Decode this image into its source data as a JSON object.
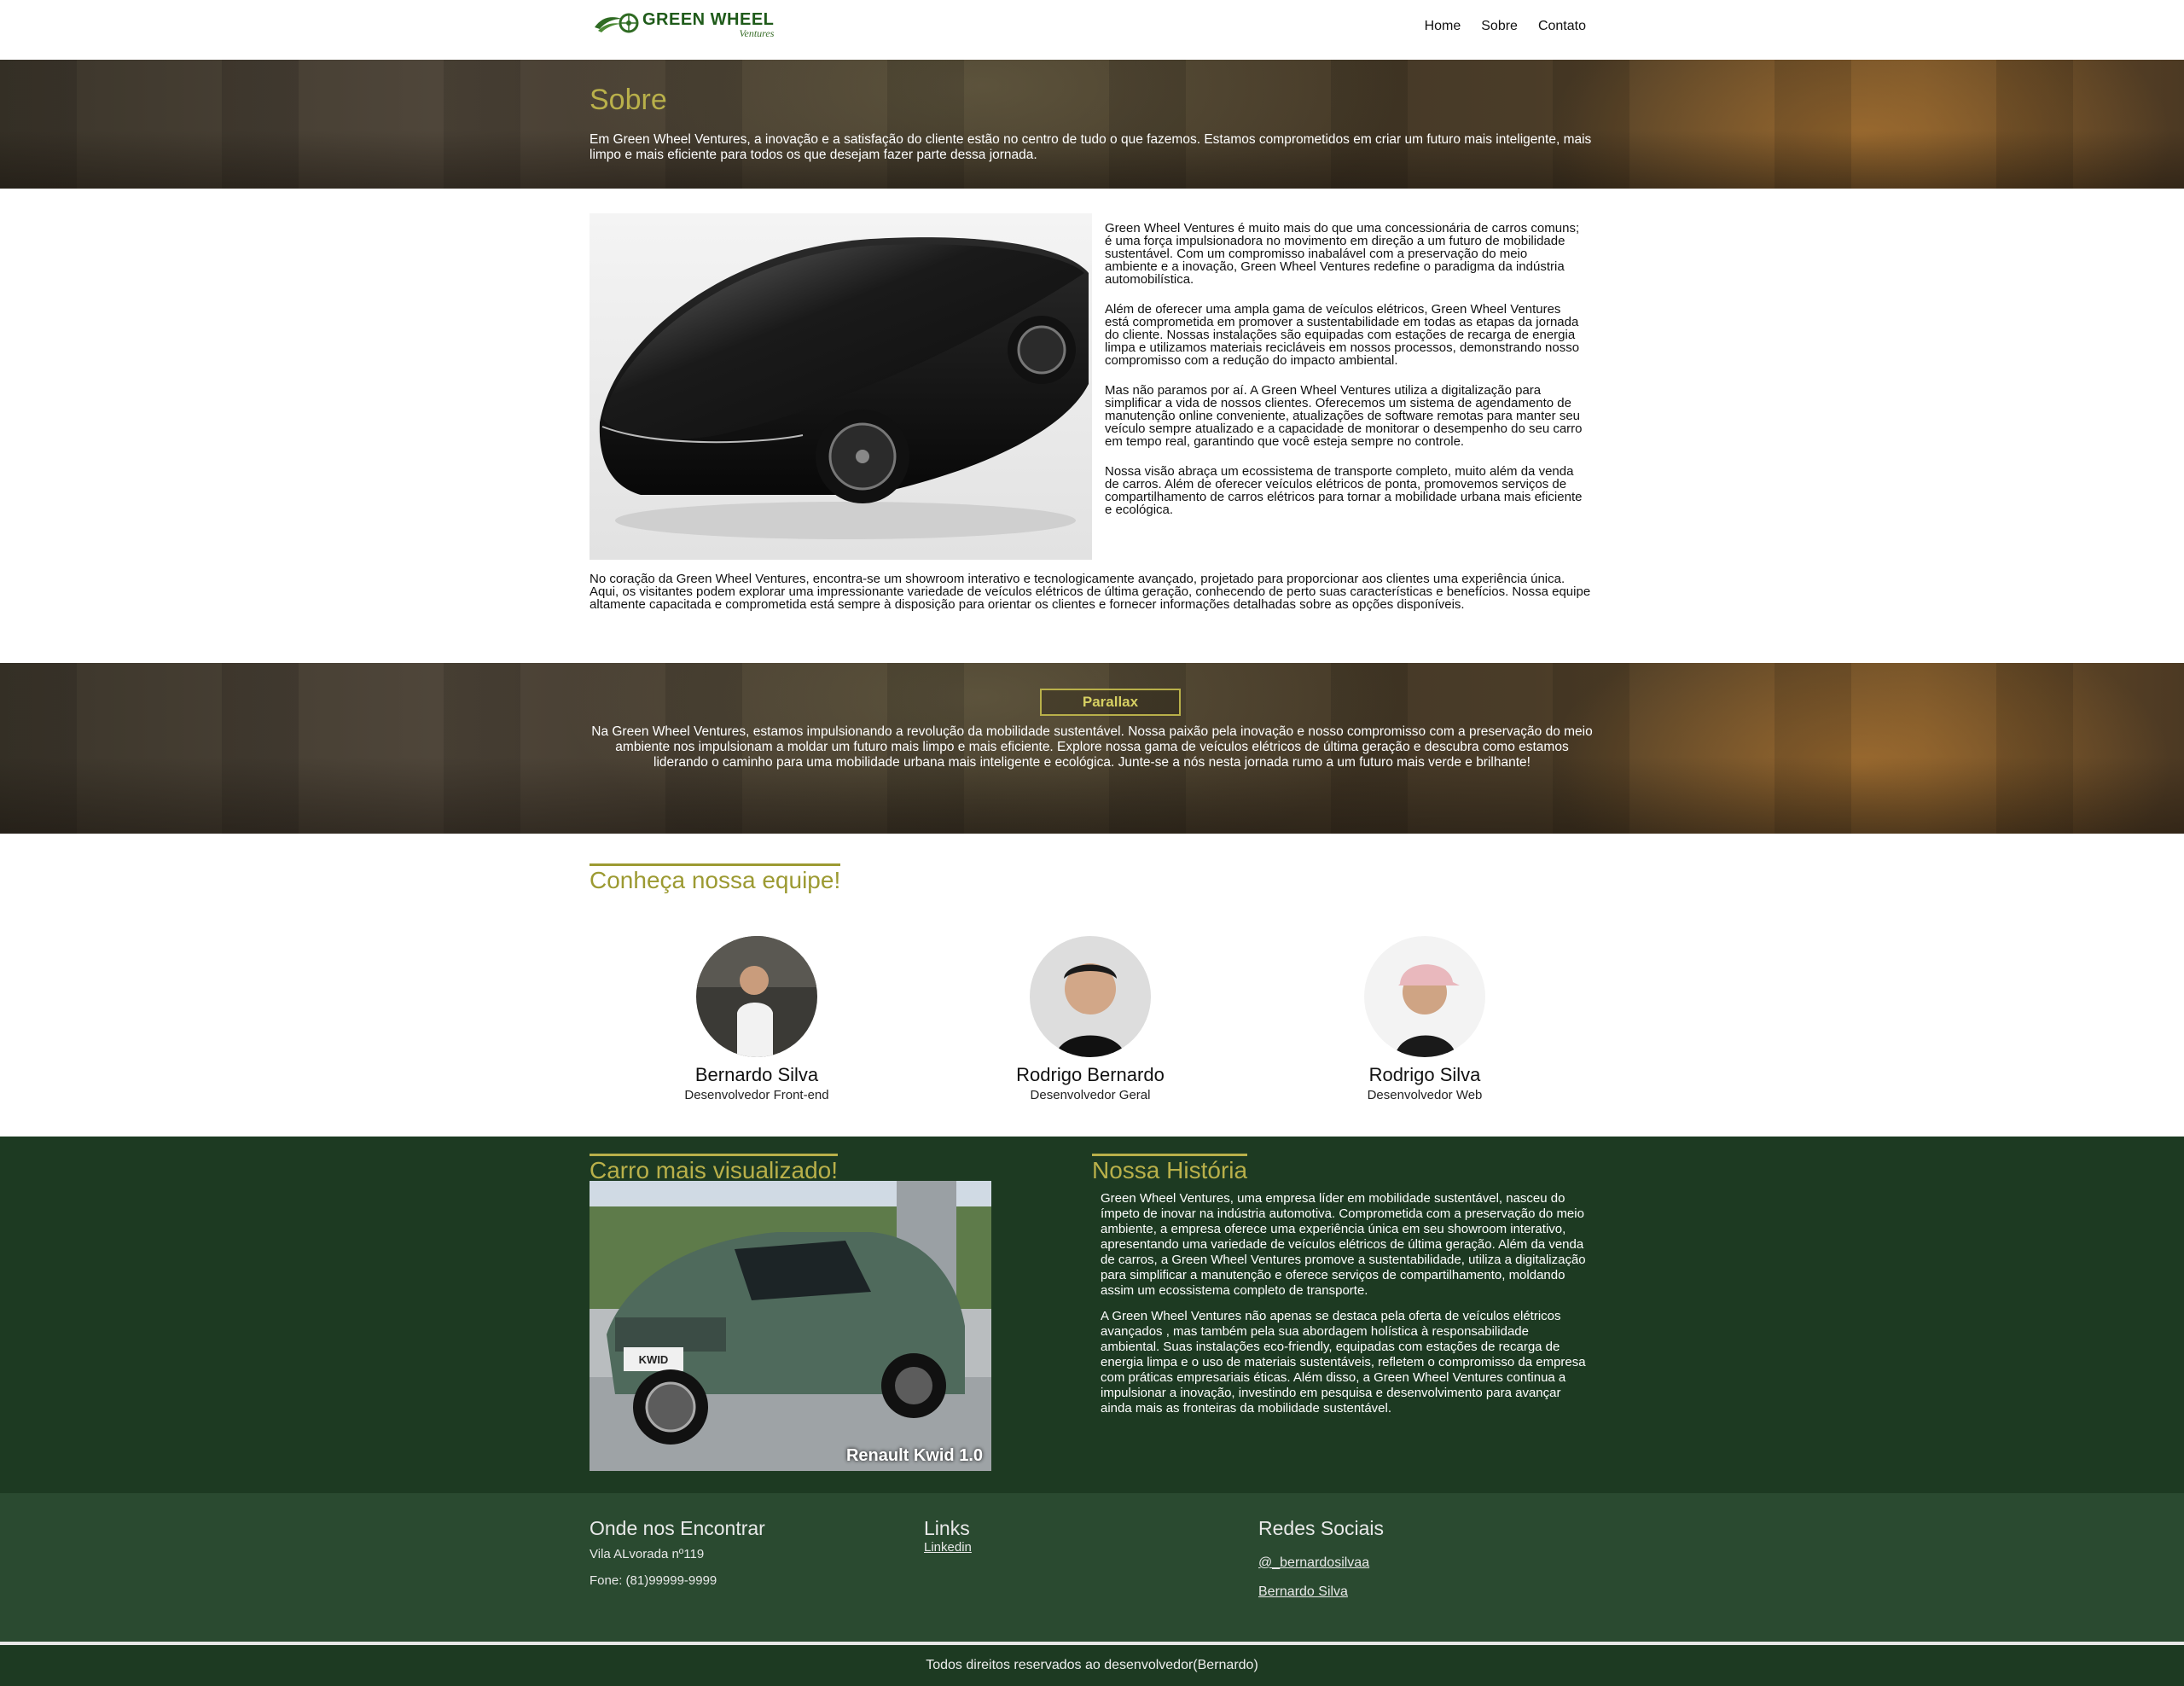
{
  "header": {
    "logo_text": "GREEN WHEEL",
    "logo_sub": "Ventures",
    "nav": [
      "Home",
      "Sobre",
      "Contato"
    ]
  },
  "sobre": {
    "title": "Sobre",
    "text": "Em Green Wheel Ventures, a inovação e a satisfação do cliente estão no centro de tudo o que fazemos. Estamos comprometidos em criar um futuro mais inteligente, mais limpo e mais eficiente para todos os que desejam fazer parte dessa jornada."
  },
  "about": {
    "paragraphs": [
      "Green Wheel Ventures é muito mais do que uma concessionária de carros comuns; é uma força impulsionadora no movimento em direção a um futuro de mobilidade sustentável. Com um compromisso inabalável com a preservação do meio ambiente e a inovação, Green Wheel Ventures redefine o paradigma da indústria automobilística.",
      "Além de oferecer uma ampla gama de veículos elétricos, Green Wheel Ventures está comprometida em promover a sustentabilidade em todas as etapas da jornada do cliente. Nossas instalações são equipadas com estações de recarga de energia limpa e utilizamos materiais recicláveis em nossos processos, demonstrando nosso compromisso com a redução do impacto ambiental.",
      "Mas não paramos por aí. A Green Wheel Ventures utiliza a digitalização para simplificar a vida de nossos clientes. Oferecemos um sistema de agendamento de manutenção online conveniente, atualizações de software remotas para manter seu veículo sempre atualizado e a capacidade de monitorar o desempenho do seu carro em tempo real, garantindo que você esteja sempre no controle.",
      "Nossa visão abraça um ecossistema de transporte completo, muito além da venda de carros. Além de oferecer veículos elétricos de ponta, promovemos serviços de compartilhamento de carros elétricos para tornar a mobilidade urbana mais eficiente e ecológica."
    ],
    "bottom": "No coração da Green Wheel Ventures, encontra-se um showroom interativo e tecnologicamente avançado, projetado para proporcionar aos clientes uma experiência única. Aqui, os visitantes podem explorar uma impressionante variedade de veículos elétricos de última geração, conhecendo de perto suas características e benefícios. Nossa equipe altamente capacitada e comprometida está sempre à disposição para orientar os clientes e fornecer informações detalhadas sobre as opções disponíveis."
  },
  "parallax": {
    "button": "Parallax",
    "text": "Na Green Wheel Ventures, estamos impulsionando a revolução da mobilidade sustentável. Nossa paixão pela inovação e nosso compromisso com a preservação do meio ambiente nos impulsionam a moldar um futuro mais limpo e mais eficiente. Explore nossa gama de veículos elétricos de última geração e descubra como estamos liderando o caminho para uma mobilidade urbana mais inteligente e ecológica. Junte-se a nós nesta jornada rumo a um futuro mais verde e brilhante!"
  },
  "team": {
    "title": "Conheça nossa equipe!",
    "members": [
      {
        "name": "Bernardo Silva",
        "role": "Desenvolvedor Front-end"
      },
      {
        "name": "Rodrigo Bernardo",
        "role": "Desenvolvedor Geral"
      },
      {
        "name": "Rodrigo Silva",
        "role": "Desenvolvedor Web"
      }
    ]
  },
  "featured": {
    "title": "Carro mais visualizado!",
    "caption": "Renault Kwid 1.0",
    "plate": "KWID"
  },
  "history": {
    "title": "Nossa História",
    "paragraphs": [
      "Green Wheel Ventures, uma empresa líder em mobilidade sustentável, nasceu do ímpeto de inovar na indústria automotiva. Comprometida com a preservação do meio ambiente, a empresa oferece uma experiência única em seu showroom interativo, apresentando uma variedade de veículos elétricos de última geração. Além da venda de carros, a Green Wheel Ventures promove a sustentabilidade, utiliza a digitalização para simplificar a manutenção e oferece serviços de compartilhamento, moldando assim um ecossistema completo de transporte.",
      "A Green Wheel Ventures não apenas se destaca pela oferta de veículos elétricos avançados , mas também pela sua abordagem holística à responsabilidade ambiental. Suas instalações eco-friendly, equipadas com estações de recarga de energia limpa e o uso de materiais sustentáveis, refletem o compromisso da empresa com práticas empresariais éticas. Além disso, a Green Wheel Ventures continua a impulsionar a inovação, investindo em pesquisa e desenvolvimento para avançar ainda mais as fronteiras da mobilidade sustentável."
    ]
  },
  "footer": {
    "location_title": "Onde nos Encontrar",
    "address": "Vila ALvorada nº119",
    "phone": "Fone: (81)99999-9999",
    "links_title": "Links",
    "linkedin": "Linkedin",
    "social_title": "Redes Sociais",
    "instagram": "@_bernardosilvaa",
    "facebook": "Bernardo Silva",
    "copyright": "Todos direitos reservados ao desenvolvedor(Bernardo)"
  },
  "colors": {
    "accent": "#b9b04a",
    "green_dark": "#1d3a22",
    "footer_green": "#2a4a30"
  }
}
